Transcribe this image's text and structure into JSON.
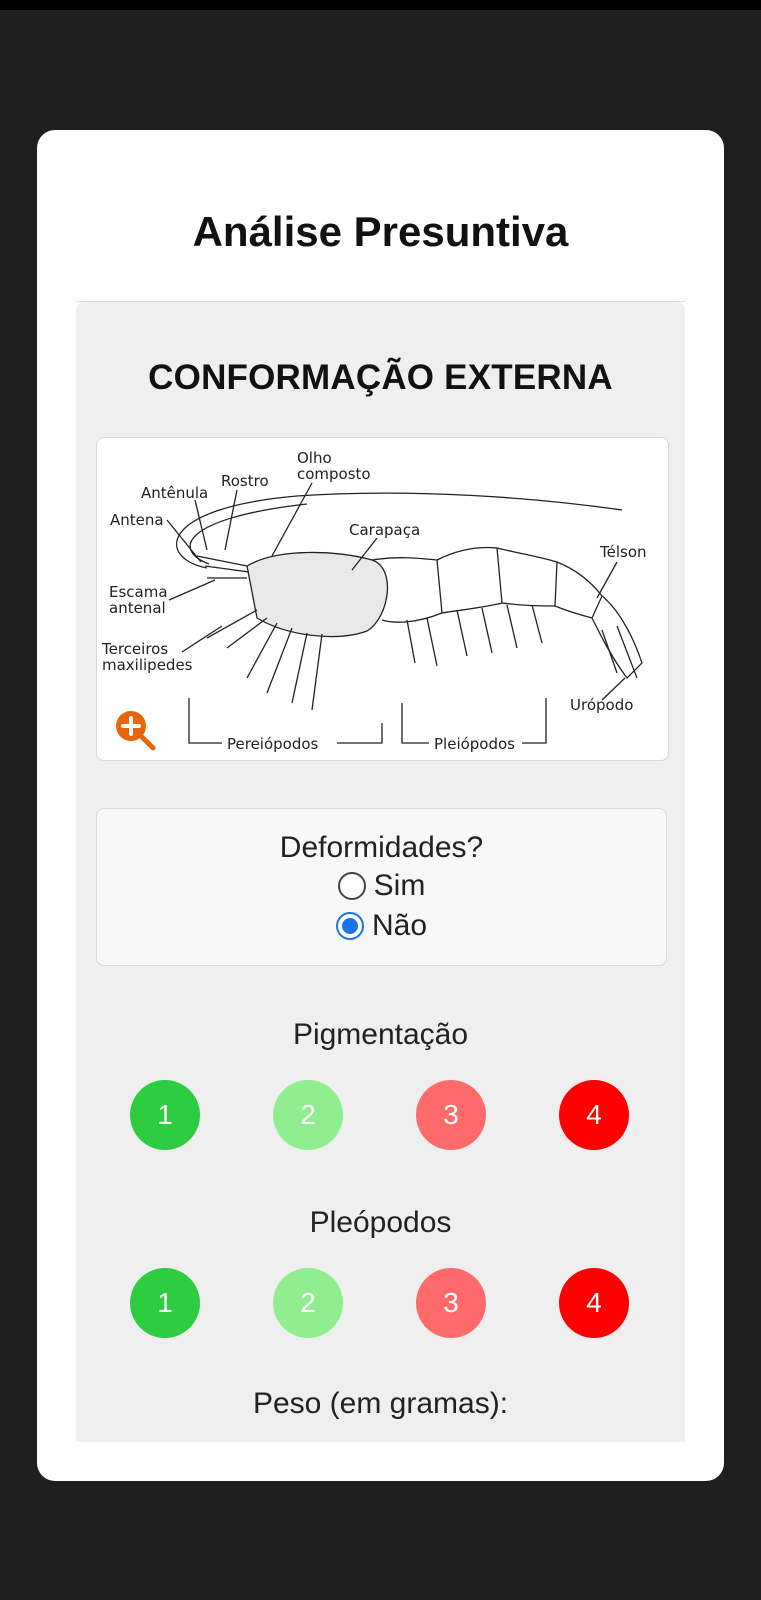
{
  "page": {
    "title": "Análise Presuntiva"
  },
  "section": {
    "title": "CONFORMAÇÃO EXTERNA"
  },
  "diagram": {
    "labels": {
      "olho": "Olho",
      "composto": "composto",
      "rostro": "Rostro",
      "antenula": "Antênula",
      "antena": "Antena",
      "carapaca": "Carapaça",
      "telson": "Télson",
      "escama": "Escama",
      "antenal": "antenal",
      "terceiros": "Terceiros",
      "maxilipedes": "maxilipedes",
      "uropodo": "Urópodo",
      "pereiopodos": "Pereiópodos",
      "pleiopodos": "Pleiópodos"
    },
    "zoom_icon": "zoom-in-icon",
    "zoom_color": "#e8650c"
  },
  "deformidades": {
    "label": "Deformidades?",
    "options": [
      "Sim",
      "Não"
    ],
    "selected": "Não"
  },
  "pigmentacao": {
    "label": "Pigmentação",
    "options": [
      "1",
      "2",
      "3",
      "4"
    ],
    "colors": [
      "#2ecc40",
      "#90ee90",
      "#ff6b6b",
      "#ff0000"
    ]
  },
  "pleopodos": {
    "label": "Pleópodos",
    "options": [
      "1",
      "2",
      "3",
      "4"
    ],
    "colors": [
      "#2ecc40",
      "#90ee90",
      "#ff6b6b",
      "#ff0000"
    ]
  },
  "peso": {
    "label": "Peso (em gramas):"
  }
}
